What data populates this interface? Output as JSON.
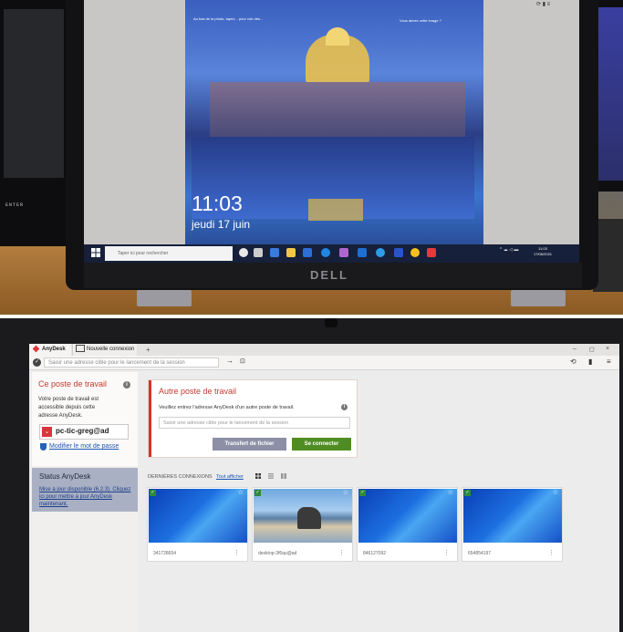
{
  "lockscreen": {
    "top_left_tip": "Au bas de la photo, tapez... pour voir des...",
    "top_right_tip": "Vous aimez cette image ?",
    "time": "11:03",
    "date": "jeudi 17 juin",
    "search_placeholder": "Taper ici pour rechercher",
    "clock_time": "11:03",
    "clock_date": "17/06/2021"
  },
  "laptop": {
    "brand": "DELL"
  },
  "left_monitor_label": "ENTER",
  "anydesk": {
    "tabs": {
      "active": "AnyDesk",
      "new_connection": "Nouvelle connexion",
      "add": "+"
    },
    "window_controls": {
      "minimize": "–",
      "maximize": "◻",
      "close": "×"
    },
    "address_bar": {
      "placeholder": "Saisir une adresse cible pour le lancement de la session"
    },
    "this_desk": {
      "title": "Ce poste de travail",
      "description": "Votre poste de travail est accessible depuis cette adresse AnyDesk.",
      "address": "pc-tic-greg@ad",
      "change_password": "Modifier le mot de passe"
    },
    "status": {
      "title": "Status AnyDesk",
      "update_text": "Mise à jour disponible (6.2.3). Cliquez ici pour mettre à jour AnyDesk maintenant."
    },
    "remote_desk": {
      "title": "Autre poste de travail",
      "description": "Veuillez entrez l'adresse AnyDesk d'un autre poste de travail.",
      "input_placeholder": "Saisir une adresse cible pour le lancement de la session",
      "transfer_button": "Transfert de fichier",
      "connect_button": "Se connecter"
    },
    "recent": {
      "heading": "DERNIÈRES CONNEXIONS",
      "show_all": "Tout afficher",
      "items": [
        {
          "address": "341728654",
          "image": "windows-10-wallpaper"
        },
        {
          "address": "desktop-3f6qu@ad",
          "image": "beach-wallpaper"
        },
        {
          "address": "846127092",
          "image": "windows-10-wallpaper"
        },
        {
          "address": "654854197",
          "image": "windows-10-wallpaper"
        }
      ]
    }
  },
  "colors": {
    "anydesk_red": "#d2352b",
    "connect_green": "#4f8d23",
    "status_panel": "#a9b0c3",
    "link_blue": "#1d56b4"
  }
}
